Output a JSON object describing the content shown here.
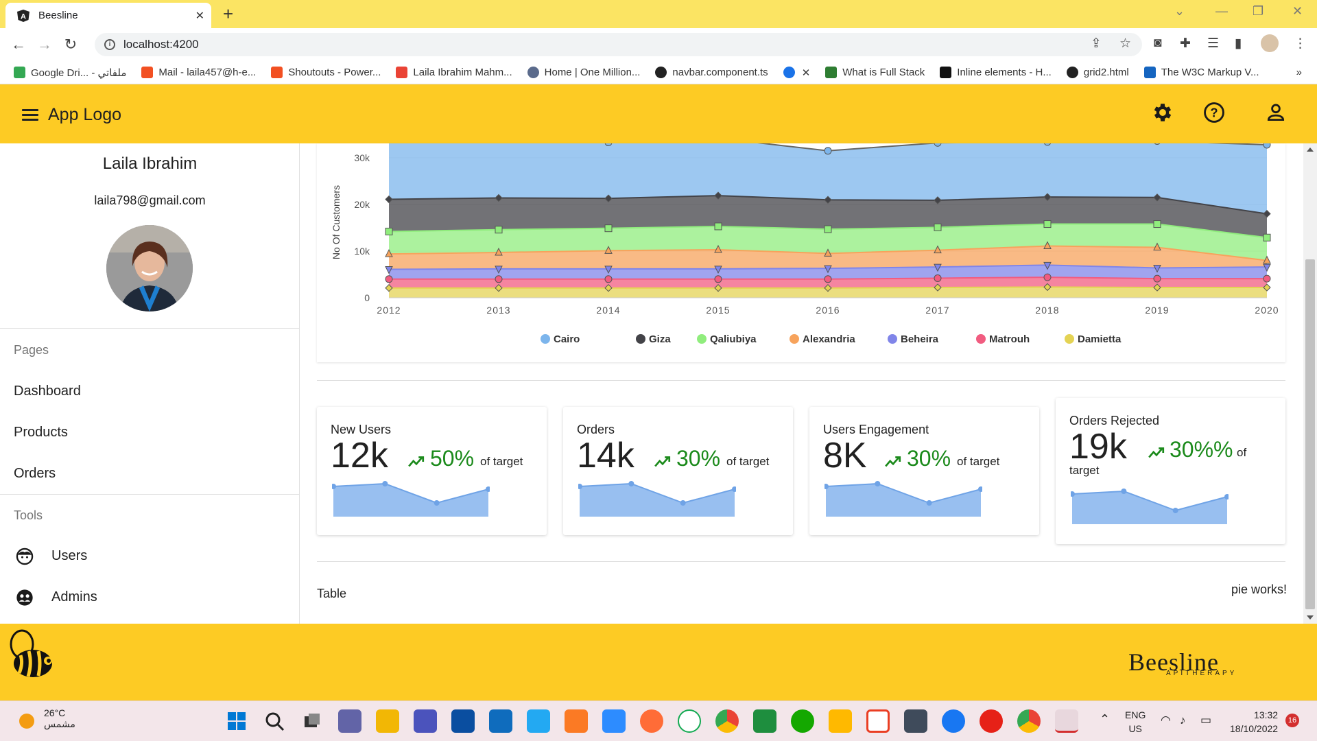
{
  "browser": {
    "tab_title": "Beesline",
    "url": "localhost:4200",
    "bookmarks": [
      {
        "label": "Google Dri... - ملفاتي",
        "color": "#34a853"
      },
      {
        "label": "Mail - laila457@h-e...",
        "color": "#f25022"
      },
      {
        "label": "Shoutouts - Power...",
        "color": "#f25022"
      },
      {
        "label": "Laila Ibrahim Mahm...",
        "color": "#ea4335"
      },
      {
        "label": "Home | One Million...",
        "color": "#5b6b8c"
      },
      {
        "label": "navbar.component.ts",
        "color": "#222222"
      },
      {
        "label": "",
        "color": "#1a73e8"
      },
      {
        "label": "What is Full Stack",
        "color": "#2e7d32"
      },
      {
        "label": "Inline elements - H...",
        "color": "#111111"
      },
      {
        "label": "grid2.html",
        "color": "#222222"
      },
      {
        "label": "The W3C Markup V...",
        "color": "#1565c0"
      }
    ]
  },
  "header": {
    "logo": "App Logo",
    "icons": [
      "settings-icon",
      "help-icon",
      "account-icon"
    ],
    "color": "#fdcb24"
  },
  "sidebar": {
    "user_name": "Laila Ibrahim",
    "user_email": "laila798@gmail.com",
    "pages_heading": "Pages",
    "pages": [
      "Dashboard",
      "Products",
      "Orders"
    ],
    "tools_heading": "Tools",
    "tools": [
      {
        "label": "Users",
        "icon": "face-icon"
      },
      {
        "label": "Admins",
        "icon": "supervisor-icon"
      }
    ]
  },
  "chart_data": {
    "type": "area",
    "ylabel": "No Of Customers",
    "x": [
      "2012",
      "2013",
      "2014",
      "2015",
      "2016",
      "2017",
      "2018",
      "2019",
      "2020"
    ],
    "y_ticks": [
      "0",
      "10k",
      "20k",
      "30k"
    ],
    "ylim": [
      0,
      33000
    ],
    "stacked": true,
    "legend_position": "bottom",
    "series": [
      {
        "name": "Cairo",
        "color": "#7cb5ec",
        "marker": "circle",
        "values": [
          13000,
          12500,
          12000,
          12300,
          10500,
          12300,
          11800,
          12100,
          14800
        ]
      },
      {
        "name": "Giza",
        "color": "#434348",
        "marker": "diamond",
        "values": [
          6900,
          6800,
          6400,
          6600,
          6300,
          5800,
          5800,
          5700,
          5100
        ]
      },
      {
        "name": "Qaliubiya",
        "color": "#90ed7d",
        "marker": "square",
        "values": [
          4800,
          4900,
          4800,
          5000,
          5200,
          4900,
          4700,
          5000,
          4900
        ]
      },
      {
        "name": "Alexandria",
        "color": "#f7a35c",
        "marker": "triangle",
        "values": [
          3300,
          3500,
          3900,
          4100,
          3200,
          3600,
          4100,
          4400,
          1400
        ]
      },
      {
        "name": "Beheira",
        "color": "#8085e9",
        "marker": "triangle-down",
        "values": [
          2100,
          2200,
          2200,
          2200,
          2300,
          2400,
          2600,
          2300,
          2500
        ]
      },
      {
        "name": "Matrouh",
        "color": "#f15c80",
        "marker": "circle",
        "values": [
          1900,
          1900,
          1900,
          1900,
          1900,
          2000,
          2100,
          1900,
          1900
        ]
      },
      {
        "name": "Damietta",
        "color": "#e4d354",
        "marker": "diamond",
        "values": [
          2100,
          2100,
          2100,
          2100,
          2100,
          2200,
          2300,
          2200,
          2200
        ]
      }
    ]
  },
  "cards": [
    {
      "title": "New Users",
      "value": "12k",
      "percent": "50%",
      "suffix": "of target",
      "spark": [
        0.9,
        1.0,
        0.3,
        0.8
      ]
    },
    {
      "title": "Orders",
      "value": "14k",
      "percent": "30%",
      "suffix": "of target",
      "spark": [
        0.9,
        1.0,
        0.3,
        0.8
      ]
    },
    {
      "title": "Users Engagement",
      "value": "8K",
      "percent": "30%",
      "suffix": "of target",
      "spark": [
        0.9,
        1.0,
        0.3,
        0.8
      ]
    },
    {
      "title": "Orders Rejected",
      "value": "19k",
      "percent": "30%%",
      "suffix": "of",
      "suffix2": "target",
      "spark": [
        0.9,
        1.0,
        0.3,
        0.8
      ]
    }
  ],
  "bottom": {
    "table_label": "Table",
    "pie_label": "pie works!"
  },
  "footer": {
    "brand": "Beesline",
    "brand_sub": "APITHERAPY"
  },
  "taskbar": {
    "temp": "26°C",
    "condition": "مشمس",
    "lang1": "ENG",
    "lang2": "US",
    "time": "13:32",
    "date": "18/10/2022",
    "notifications": "16"
  }
}
